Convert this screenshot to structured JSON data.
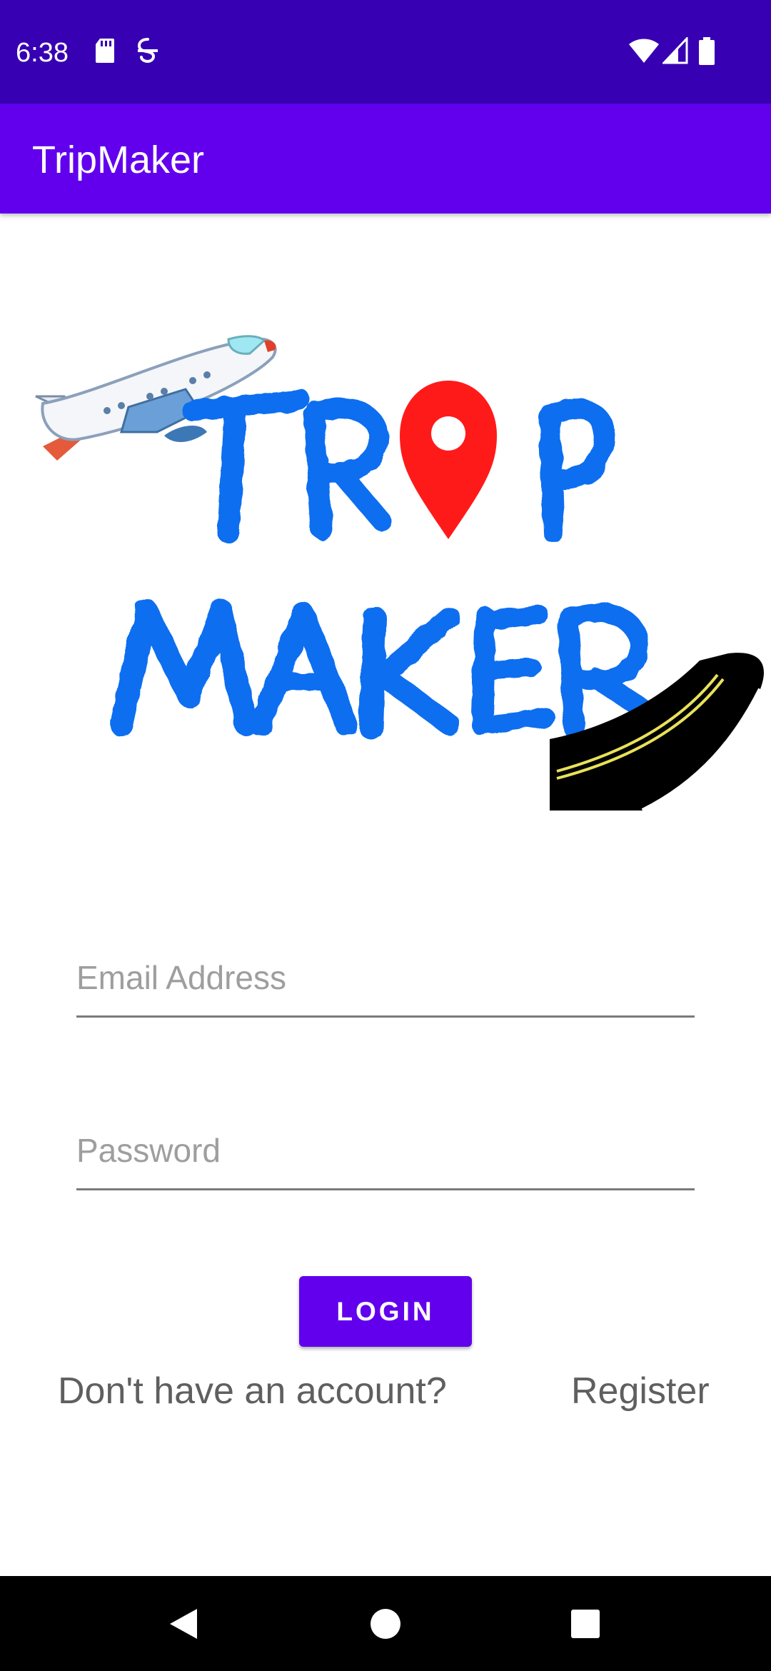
{
  "status_bar": {
    "time": "6:38",
    "icons_left": [
      "sd-card-icon",
      "vpn-key-icon"
    ],
    "icons_right": [
      "wifi-icon",
      "cell-signal-icon",
      "battery-icon"
    ]
  },
  "app_bar": {
    "title": "TripMaker"
  },
  "logo": {
    "line1": "TR",
    "line1_end": "P",
    "line2": "MAKER"
  },
  "form": {
    "email_placeholder": "Email Address",
    "email_value": "",
    "password_placeholder": "Password",
    "password_value": "",
    "login_label": "LOGIN",
    "no_account_text": "Don't have an account?",
    "register_label": "Register"
  },
  "nav_bar": {
    "icons": [
      "back-icon",
      "home-icon",
      "recents-icon"
    ]
  },
  "colors": {
    "status_bar": "#3700B3",
    "primary": "#6200EE",
    "logo_blue": "#0A6EF0",
    "pin_red": "#FF1A1A"
  }
}
